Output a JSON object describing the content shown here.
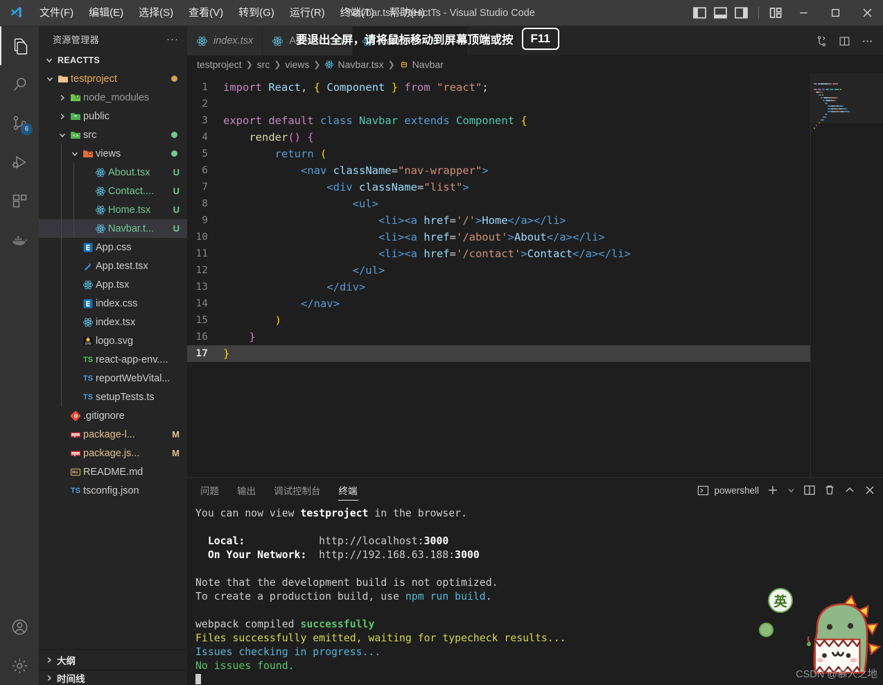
{
  "titlebar": {
    "app_icon": "vscode-logo",
    "title": "Navbar.tsx - ReactTs - Visual Studio Code",
    "menus": [
      {
        "label": "文件(F)",
        "name": "menu-file"
      },
      {
        "label": "编辑(E)",
        "name": "menu-edit"
      },
      {
        "label": "选择(S)",
        "name": "menu-selection"
      },
      {
        "label": "查看(V)",
        "name": "menu-view"
      },
      {
        "label": "转到(G)",
        "name": "menu-go"
      },
      {
        "label": "运行(R)",
        "name": "menu-run"
      },
      {
        "label": "终端(T)",
        "name": "menu-terminal"
      },
      {
        "label": "帮助(H)",
        "name": "menu-help"
      }
    ],
    "layout_controls": [
      "toggle-primary-sidebar-icon",
      "toggle-panel-icon",
      "toggle-secondary-sidebar-icon",
      "customize-layout-icon"
    ],
    "window_controls": [
      "minimize-icon",
      "maximize-icon",
      "close-icon"
    ]
  },
  "fullscreen_notice": {
    "text": "要退出全屏，请将鼠标移动到屏幕顶端或按",
    "key": "F11"
  },
  "activitybar": {
    "items": [
      {
        "name": "activity-explorer",
        "icon": "files-icon",
        "active": true,
        "badge": ""
      },
      {
        "name": "activity-search",
        "icon": "search-icon",
        "active": false,
        "badge": ""
      },
      {
        "name": "activity-source-control",
        "icon": "source-control-icon",
        "active": false,
        "badge": "6"
      },
      {
        "name": "activity-run-debug",
        "icon": "run-debug-icon",
        "active": false,
        "badge": ""
      },
      {
        "name": "activity-extensions",
        "icon": "extensions-icon",
        "active": false,
        "badge": ""
      },
      {
        "name": "activity-docker",
        "icon": "docker-whale-icon",
        "active": false,
        "badge": ""
      }
    ],
    "bottom": [
      {
        "name": "activity-accounts",
        "icon": "account-icon"
      },
      {
        "name": "activity-settings",
        "icon": "gear-icon"
      }
    ]
  },
  "sidebar": {
    "title": "资源管理器",
    "more_actions": "···",
    "root_label": "REACTTS",
    "tree": [
      {
        "label": "testproject",
        "depth": 1,
        "icon": "folder-open",
        "color": "#e8ab53",
        "twisty": "down",
        "dot": "#cfa155",
        "selected": false
      },
      {
        "label": "node_modules",
        "depth": 2,
        "icon": "folder-node",
        "color": "#9a9a9a",
        "twisty": "right",
        "dot": "",
        "selected": false
      },
      {
        "label": "public",
        "depth": 2,
        "icon": "folder-public",
        "color": "#cccccc",
        "twisty": "right",
        "dot": "",
        "selected": false
      },
      {
        "label": "src",
        "depth": 2,
        "icon": "folder-src",
        "color": "#cccccc",
        "twisty": "down",
        "dot": "#73c991",
        "selected": false
      },
      {
        "label": "views",
        "depth": 3,
        "icon": "folder-views",
        "color": "#cccccc",
        "twisty": "down",
        "dot": "#73c991",
        "selected": false
      },
      {
        "label": "About.tsx",
        "depth": 4,
        "icon": "react",
        "color": "#73c991",
        "twisty": "",
        "mark": "U",
        "markColor": "#73c991",
        "selected": false
      },
      {
        "label": "Contact....",
        "depth": 4,
        "icon": "react",
        "color": "#73c991",
        "twisty": "",
        "mark": "U",
        "markColor": "#73c991",
        "selected": false
      },
      {
        "label": "Home.tsx",
        "depth": 4,
        "icon": "react",
        "color": "#73c991",
        "twisty": "",
        "mark": "U",
        "markColor": "#73c991",
        "selected": false
      },
      {
        "label": "Navbar.t...",
        "depth": 4,
        "icon": "react",
        "color": "#73c991",
        "twisty": "",
        "mark": "U",
        "markColor": "#73c991",
        "selected": true
      },
      {
        "label": "App.css",
        "depth": 3,
        "icon": "css",
        "color": "#cccccc",
        "twisty": "",
        "selected": false
      },
      {
        "label": "App.test.tsx",
        "depth": 3,
        "icon": "test",
        "color": "#cccccc",
        "twisty": "",
        "selected": false
      },
      {
        "label": "App.tsx",
        "depth": 3,
        "icon": "react",
        "color": "#cccccc",
        "twisty": "",
        "selected": false
      },
      {
        "label": "index.css",
        "depth": 3,
        "icon": "css",
        "color": "#cccccc",
        "twisty": "",
        "selected": false
      },
      {
        "label": "index.tsx",
        "depth": 3,
        "icon": "react",
        "color": "#cccccc",
        "twisty": "",
        "selected": false
      },
      {
        "label": "logo.svg",
        "depth": 3,
        "icon": "svg",
        "color": "#cccccc",
        "twisty": "",
        "selected": false
      },
      {
        "label": "react-app-env....",
        "depth": 3,
        "icon": "ts-green",
        "color": "#cccccc",
        "twisty": "",
        "selected": false
      },
      {
        "label": "reportWebVital...",
        "depth": 3,
        "icon": "ts-blue",
        "color": "#cccccc",
        "twisty": "",
        "selected": false
      },
      {
        "label": "setupTests.ts",
        "depth": 3,
        "icon": "ts-blue",
        "color": "#cccccc",
        "twisty": "",
        "selected": false
      },
      {
        "label": ".gitignore",
        "depth": 2,
        "icon": "git",
        "color": "#cccccc",
        "twisty": "",
        "selected": false
      },
      {
        "label": "package-l...",
        "depth": 2,
        "icon": "npm",
        "color": "#e2c08d",
        "twisty": "",
        "mark": "M",
        "markColor": "#e2c08d",
        "selected": false
      },
      {
        "label": "package.js...",
        "depth": 2,
        "icon": "npm",
        "color": "#e2c08d",
        "twisty": "",
        "mark": "M",
        "markColor": "#e2c08d",
        "selected": false
      },
      {
        "label": "README.md",
        "depth": 2,
        "icon": "md",
        "color": "#cccccc",
        "twisty": "",
        "selected": false
      },
      {
        "label": "tsconfig.json",
        "depth": 2,
        "icon": "ts-blue",
        "color": "#cccccc",
        "twisty": "",
        "selected": false
      }
    ],
    "bottom_panels": [
      {
        "label": "大纲",
        "name": "sidebar-panel-outline"
      },
      {
        "label": "时间线",
        "name": "sidebar-panel-timeline"
      }
    ]
  },
  "tabs": [
    {
      "label": "index.tsx",
      "name": "tab-index-tsx",
      "icon": "react-icon",
      "active": false,
      "italic": true,
      "mark": ""
    },
    {
      "label": "About.tsx",
      "name": "tab-about-tsx",
      "icon": "react-icon",
      "active": false,
      "italic": false,
      "mark": "U"
    },
    {
      "label": "Navbar.tsx",
      "name": "tab-navbar-tsx",
      "icon": "react-icon",
      "active": true,
      "italic": false,
      "mark": "U"
    }
  ],
  "tabbar_actions": [
    "split-source-control-icon",
    "split-editor-icon",
    "more-actions-icon"
  ],
  "breadcrumbs": [
    {
      "label": "testproject",
      "icon": ""
    },
    {
      "label": "src",
      "icon": ""
    },
    {
      "label": "views",
      "icon": ""
    },
    {
      "label": "Navbar.tsx",
      "icon": "react-icon"
    },
    {
      "label": "Navbar",
      "icon": "class-icon"
    }
  ],
  "editor": {
    "current_line": 17,
    "lines": [
      {
        "n": 1,
        "tokens": [
          {
            "t": "import",
            "c": "kw"
          },
          {
            "t": " ",
            "c": "p"
          },
          {
            "t": "React",
            "c": "var"
          },
          {
            "t": ",",
            "c": "p"
          },
          {
            "t": " ",
            "c": "p"
          },
          {
            "t": "{",
            "c": "brace1"
          },
          {
            "t": " Component ",
            "c": "var"
          },
          {
            "t": "}",
            "c": "brace1"
          },
          {
            "t": " ",
            "c": "p"
          },
          {
            "t": "from",
            "c": "kw"
          },
          {
            "t": " ",
            "c": "p"
          },
          {
            "t": "\"react\"",
            "c": "str"
          },
          {
            "t": ";",
            "c": "p"
          }
        ]
      },
      {
        "n": 2,
        "tokens": []
      },
      {
        "n": 3,
        "tokens": [
          {
            "t": "export",
            "c": "kw"
          },
          {
            "t": " ",
            "c": "p"
          },
          {
            "t": "default",
            "c": "kw"
          },
          {
            "t": " ",
            "c": "p"
          },
          {
            "t": "class",
            "c": "kw2"
          },
          {
            "t": " ",
            "c": "p"
          },
          {
            "t": "Navbar",
            "c": "cls"
          },
          {
            "t": " ",
            "c": "p"
          },
          {
            "t": "extends",
            "c": "kw2"
          },
          {
            "t": " ",
            "c": "p"
          },
          {
            "t": "Component",
            "c": "cls2"
          },
          {
            "t": " ",
            "c": "p"
          },
          {
            "t": "{",
            "c": "brace1"
          }
        ]
      },
      {
        "n": 4,
        "tokens": [
          {
            "t": "    ",
            "c": "p"
          },
          {
            "t": "render",
            "c": "fn"
          },
          {
            "t": "()",
            "c": "brace2"
          },
          {
            "t": " ",
            "c": "p"
          },
          {
            "t": "{",
            "c": "brace3"
          }
        ]
      },
      {
        "n": 5,
        "tokens": [
          {
            "t": "        ",
            "c": "p"
          },
          {
            "t": "return",
            "c": "kw2"
          },
          {
            "t": " ",
            "c": "p"
          },
          {
            "t": "(",
            "c": "brace1"
          }
        ]
      },
      {
        "n": 6,
        "tokens": [
          {
            "t": "            ",
            "c": "p"
          },
          {
            "t": "<nav",
            "c": "tag"
          },
          {
            "t": " ",
            "c": "p"
          },
          {
            "t": "className",
            "c": "attr"
          },
          {
            "t": "=",
            "c": "p"
          },
          {
            "t": "\"nav-wrapper\"",
            "c": "str2"
          },
          {
            "t": ">",
            "c": "tag"
          }
        ]
      },
      {
        "n": 7,
        "tokens": [
          {
            "t": "                ",
            "c": "p"
          },
          {
            "t": "<div",
            "c": "tag"
          },
          {
            "t": " ",
            "c": "p"
          },
          {
            "t": "className",
            "c": "attr"
          },
          {
            "t": "=",
            "c": "p"
          },
          {
            "t": "\"list\"",
            "c": "str2"
          },
          {
            "t": ">",
            "c": "tag"
          }
        ]
      },
      {
        "n": 8,
        "tokens": [
          {
            "t": "                    ",
            "c": "p"
          },
          {
            "t": "<ul>",
            "c": "tag"
          }
        ]
      },
      {
        "n": 9,
        "tokens": [
          {
            "t": "                        ",
            "c": "p"
          },
          {
            "t": "<li><a",
            "c": "tag"
          },
          {
            "t": " ",
            "c": "p"
          },
          {
            "t": "href",
            "c": "attr"
          },
          {
            "t": "=",
            "c": "p"
          },
          {
            "t": "'/'",
            "c": "str2"
          },
          {
            "t": ">",
            "c": "tag"
          },
          {
            "t": "Home",
            "c": "txt"
          },
          {
            "t": "</a></li>",
            "c": "tag"
          }
        ]
      },
      {
        "n": 10,
        "tokens": [
          {
            "t": "                        ",
            "c": "p"
          },
          {
            "t": "<li><a",
            "c": "tag"
          },
          {
            "t": " ",
            "c": "p"
          },
          {
            "t": "href",
            "c": "attr"
          },
          {
            "t": "=",
            "c": "p"
          },
          {
            "t": "'/about'",
            "c": "str2"
          },
          {
            "t": ">",
            "c": "tag"
          },
          {
            "t": "About",
            "c": "txt"
          },
          {
            "t": "</a></li>",
            "c": "tag"
          }
        ]
      },
      {
        "n": 11,
        "tokens": [
          {
            "t": "                        ",
            "c": "p"
          },
          {
            "t": "<li><a",
            "c": "tag"
          },
          {
            "t": " ",
            "c": "p"
          },
          {
            "t": "href",
            "c": "attr"
          },
          {
            "t": "=",
            "c": "p"
          },
          {
            "t": "'/contact'",
            "c": "str2"
          },
          {
            "t": ">",
            "c": "tag"
          },
          {
            "t": "Contact",
            "c": "txt"
          },
          {
            "t": "</a></li>",
            "c": "tag"
          }
        ]
      },
      {
        "n": 12,
        "tokens": [
          {
            "t": "                    ",
            "c": "p"
          },
          {
            "t": "</ul>",
            "c": "tag"
          }
        ]
      },
      {
        "n": 13,
        "tokens": [
          {
            "t": "                ",
            "c": "p"
          },
          {
            "t": "</div>",
            "c": "tag"
          }
        ]
      },
      {
        "n": 14,
        "tokens": [
          {
            "t": "            ",
            "c": "p"
          },
          {
            "t": "</nav>",
            "c": "tag"
          }
        ]
      },
      {
        "n": 15,
        "tokens": [
          {
            "t": "        ",
            "c": "p"
          },
          {
            "t": ")",
            "c": "brace1"
          }
        ]
      },
      {
        "n": 16,
        "tokens": [
          {
            "t": "    ",
            "c": "p"
          },
          {
            "t": "}",
            "c": "brace3"
          }
        ]
      },
      {
        "n": 17,
        "tokens": [
          {
            "t": "}",
            "c": "brace1"
          }
        ]
      }
    ]
  },
  "panel": {
    "tabs": [
      {
        "label": "问题",
        "name": "panel-tab-problems",
        "active": false
      },
      {
        "label": "输出",
        "name": "panel-tab-output",
        "active": false
      },
      {
        "label": "调试控制台",
        "name": "panel-tab-debug-console",
        "active": false
      },
      {
        "label": "终端",
        "name": "panel-tab-terminal",
        "active": true
      }
    ],
    "terminal_name": "powershell",
    "actions": [
      "new-terminal-icon",
      "terminal-dropdown-icon",
      "split-terminal-icon",
      "kill-terminal-icon",
      "maximize-panel-icon",
      "close-panel-icon"
    ],
    "terminal_lines": [
      [
        {
          "t": "You can now view ",
          "c": "t-white"
        },
        {
          "t": "testproject",
          "c": "t-bold"
        },
        {
          "t": " in the browser.",
          "c": "t-white"
        }
      ],
      [],
      [
        {
          "t": "  Local:            ",
          "c": "t-bold"
        },
        {
          "t": "http://localhost:",
          "c": "t-white"
        },
        {
          "t": "3000",
          "c": "t-bold"
        }
      ],
      [
        {
          "t": "  On Your Network:  ",
          "c": "t-bold"
        },
        {
          "t": "http://192.168.63.188:",
          "c": "t-white"
        },
        {
          "t": "3000",
          "c": "t-bold"
        }
      ],
      [],
      [
        {
          "t": "Note that the development build is not optimized.",
          "c": "t-white"
        }
      ],
      [
        {
          "t": "To create a production build, use ",
          "c": "t-white"
        },
        {
          "t": "npm run build",
          "c": "t-cyan"
        },
        {
          "t": ".",
          "c": "t-white"
        }
      ],
      [],
      [
        {
          "t": "webpack compiled ",
          "c": "t-white"
        },
        {
          "t": "successfully",
          "c": "t-green-bold"
        }
      ],
      [
        {
          "t": "Files successfully emitted, waiting for typecheck results...",
          "c": "t-yellow"
        }
      ],
      [
        {
          "t": "Issues checking in progress...",
          "c": "t-cyan"
        }
      ],
      [
        {
          "t": "No issues found.",
          "c": "t-green"
        }
      ]
    ]
  },
  "watermark": "CSDN @慕人之地",
  "ime": {
    "label": "英"
  },
  "colors": {
    "accent": "#0e70c0",
    "green_status": "#73c991",
    "modified": "#e2c08d",
    "bg_editor": "#1e1e1e",
    "bg_sidebar": "#252526",
    "bg_activity": "#333333",
    "bg_title": "#3c3c3c"
  }
}
